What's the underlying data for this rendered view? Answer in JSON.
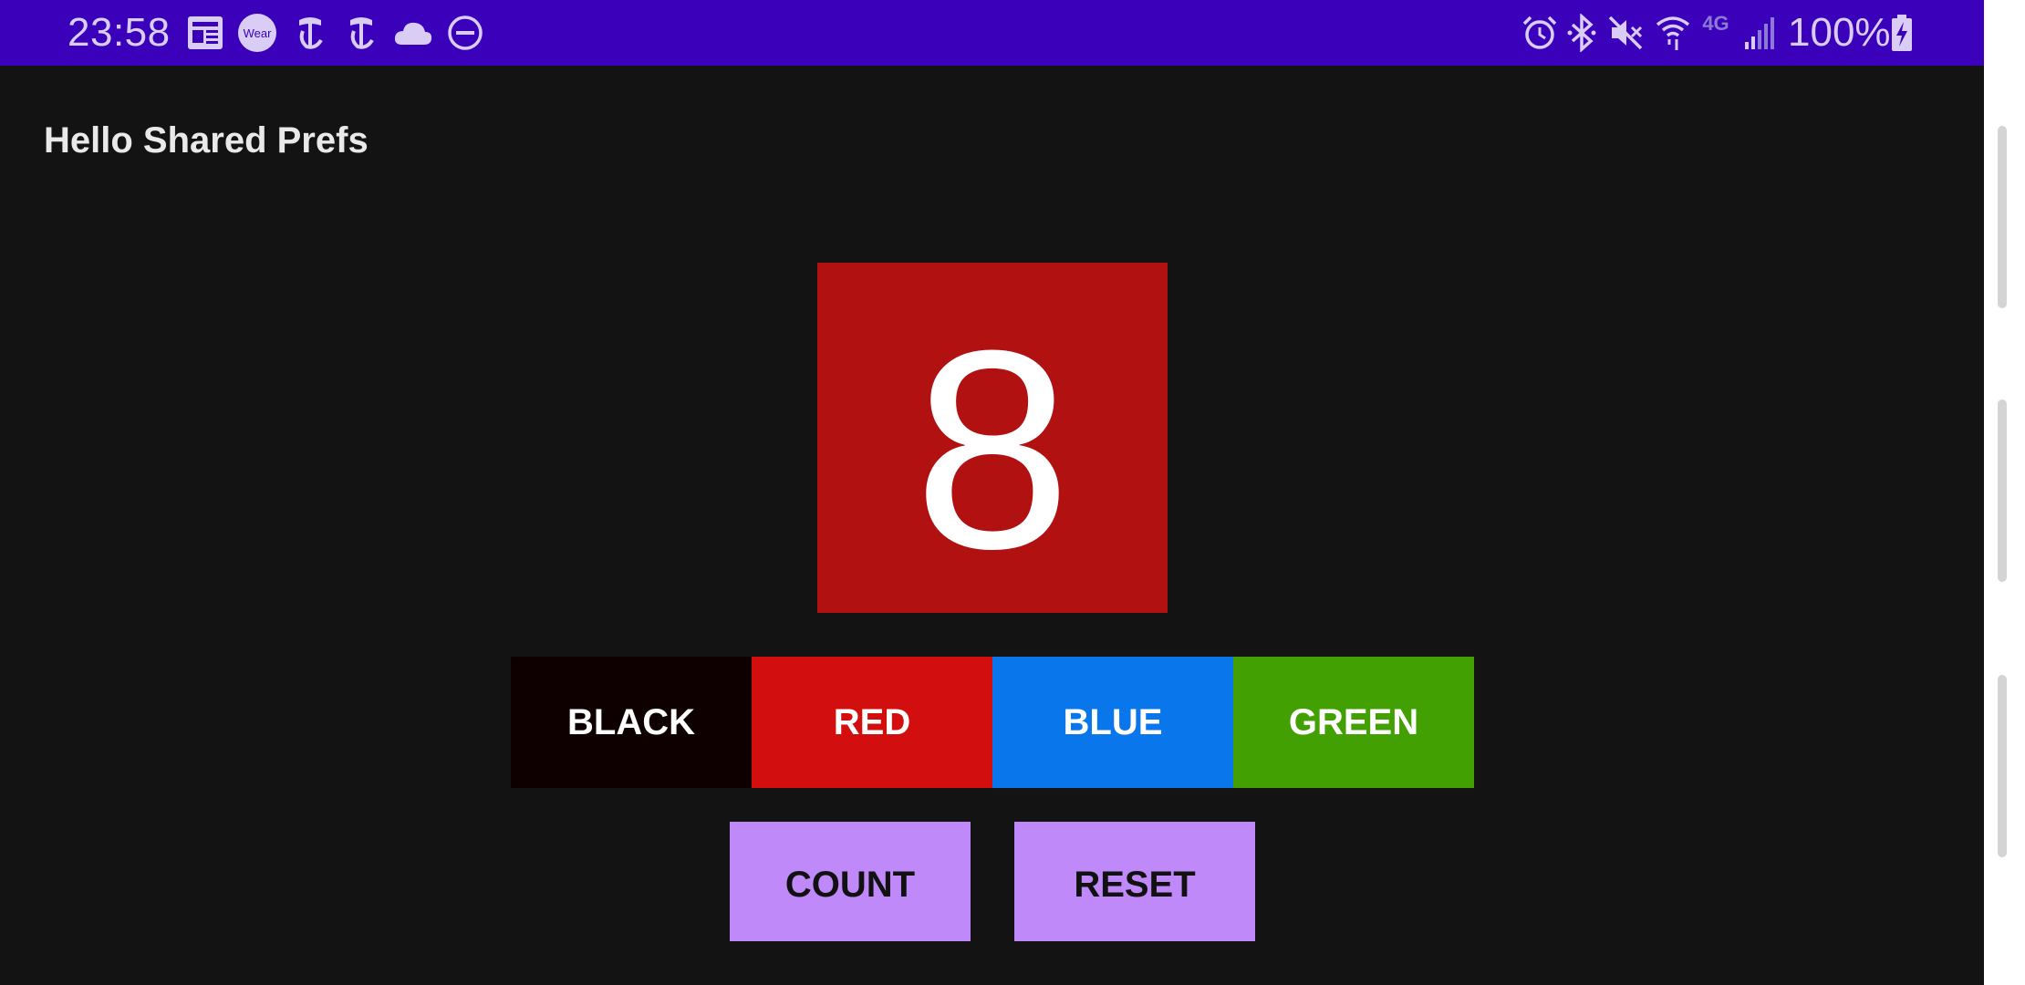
{
  "status_bar": {
    "time": "23:58",
    "battery_text": "100%",
    "left_icons": [
      "news-icon",
      "wear-icon",
      "nyt-icon",
      "nyt-icon",
      "cloud-icon",
      "do-not-disturb-icon"
    ],
    "right_icons": [
      "alarm-icon",
      "bluetooth-icon",
      "mute-icon",
      "wifi-icon",
      "4g-icon",
      "signal-icon",
      "battery-charging-icon"
    ],
    "wear_label": "Wear",
    "network_label": "4G",
    "background_color": "#3b00b9"
  },
  "app": {
    "title": "Hello Shared Prefs"
  },
  "counter": {
    "value": "8",
    "background_color": "#b21111"
  },
  "color_buttons": [
    {
      "label": "BLACK",
      "color": "#0e0000"
    },
    {
      "label": "RED",
      "color": "#d20e0e"
    },
    {
      "label": "BLUE",
      "color": "#0a76ec"
    },
    {
      "label": "GREEN",
      "color": "#43a003"
    }
  ],
  "actions": {
    "count_label": "COUNT",
    "reset_label": "RESET",
    "button_color": "#bf89fa"
  }
}
